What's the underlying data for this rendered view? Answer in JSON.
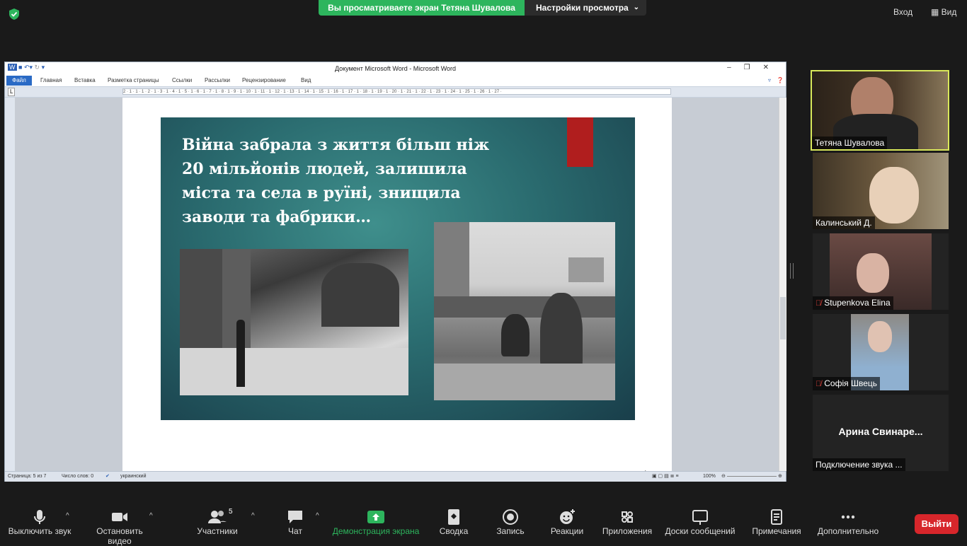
{
  "top_bar": {
    "sharing_banner": "Вы просматриваете экран Тетяна Шувалова",
    "view_settings": "Настройки просмотра",
    "login": "Вход",
    "view": "Вид"
  },
  "word": {
    "title": "Документ Microsoft Word  -  Microsoft Word",
    "tabs": [
      "Файл",
      "Главная",
      "Вставка",
      "Разметка страницы",
      "Ссылки",
      "Рассылки",
      "Рецензирование",
      "Вид"
    ],
    "ruler_numbers": "2 · 1 · 1 · 1 · 2 · 1 · 3 · 1 · 4 · 1 · 5 · 1 · 6 · 1 · 7 · 1 · 8 · 1 · 9 · 1 · 10 · 1 · 11 · 1 · 12 · 1 · 13 · 1 · 14 · 1 · 15 · 1 · 16 · 1 · 17 · 1 · 18 · 1 · 19 · 1 · 20 · 1 · 21 · 1 · 22 · 1 · 23 · 1 · 24 · 1 · 25 · 1 · 26 · 1 · 27 ·",
    "slide_text": "Війна  забрала з життя більш ніж 20 мільйонів людей, залишила міста та села в руїні, знищила заводи та фабрики…",
    "status": {
      "page": "Страница: 5 из 7",
      "words": "Число слов: 0",
      "language": "украинский",
      "zoom": "100%"
    }
  },
  "participants": [
    {
      "name": "Тетяна Шувалова",
      "muted": false
    },
    {
      "name": "Калинський Д.",
      "muted": false
    },
    {
      "name": "Stupenkova Elina",
      "muted": true
    },
    {
      "name": "Софія Швець",
      "muted": true
    },
    {
      "name": "Подключение звука ...",
      "display": "Арина  Свинаре..."
    }
  ],
  "toolbar": {
    "mute": "Выключить звук",
    "video": "Остановить видео",
    "participants": "Участники",
    "participants_count": "5",
    "chat": "Чат",
    "share": "Демонстрация экрана",
    "summary": "Сводка",
    "record": "Запись",
    "reactions": "Реакции",
    "apps": "Приложения",
    "whiteboards": "Доски сообщений",
    "notes": "Примечания",
    "more": "Дополнительно",
    "leave": "Выйти"
  },
  "colors": {
    "share_green": "#2db55d",
    "leave_red": "#d7262b",
    "active_speaker_border": "#d9e85a"
  }
}
